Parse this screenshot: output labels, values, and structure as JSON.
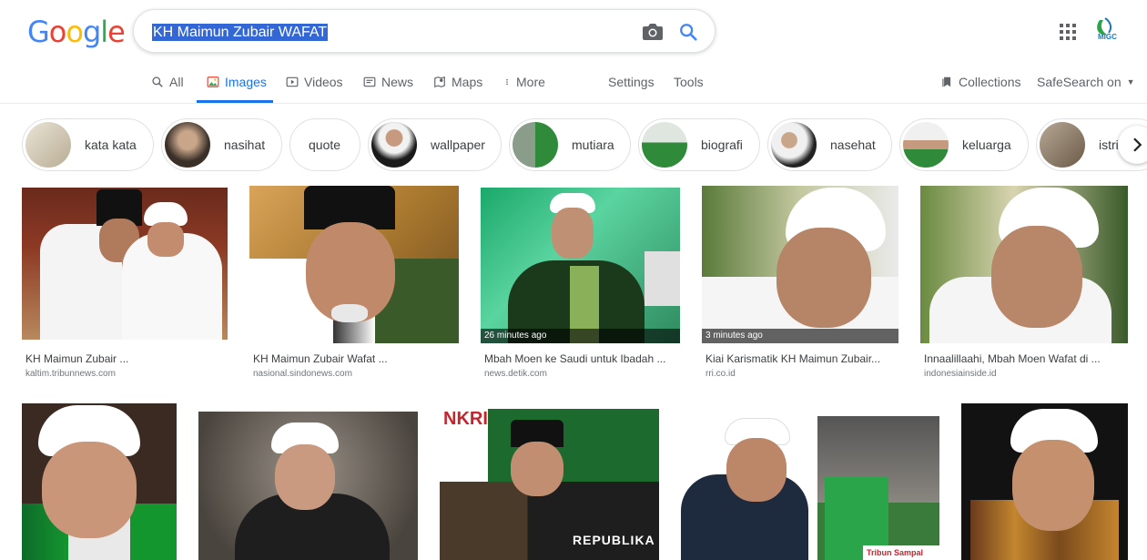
{
  "header": {
    "logo_text": "Google",
    "search_query": "KH Maimun Zubair WAFAT",
    "camera_icon": "camera-icon",
    "search_icon": "search-icon",
    "apps_icon": "apps-grid-icon",
    "account_label": "MIGC"
  },
  "nav": {
    "tabs": [
      {
        "label": "All",
        "icon": "search-icon"
      },
      {
        "label": "Images",
        "icon": "image-icon",
        "active": true
      },
      {
        "label": "Videos",
        "icon": "video-icon"
      },
      {
        "label": "News",
        "icon": "news-icon"
      },
      {
        "label": "Maps",
        "icon": "map-icon"
      },
      {
        "label": "More",
        "icon": "more-vert-icon"
      }
    ],
    "settings": "Settings",
    "tools": "Tools",
    "collections": "Collections",
    "safesearch": "SafeSearch on"
  },
  "chips": [
    {
      "label": "kata kata"
    },
    {
      "label": "nasihat"
    },
    {
      "label": "quote"
    },
    {
      "label": "wallpaper"
    },
    {
      "label": "mutiara"
    },
    {
      "label": "biografi"
    },
    {
      "label": "nasehat"
    },
    {
      "label": "keluarga"
    },
    {
      "label": "istri"
    }
  ],
  "results_row1": [
    {
      "title": "KH Maimun Zubair ...",
      "domain": "kaltim.tribunnews.com",
      "badge": ""
    },
    {
      "title": "KH Maimun Zubair Wafat ...",
      "domain": "nasional.sindonews.com",
      "badge": ""
    },
    {
      "title": "Mbah Moen ke Saudi untuk Ibadah ...",
      "domain": "news.detik.com",
      "badge": "26 minutes ago"
    },
    {
      "title": "Kiai Karismatik KH Maimun Zubair...",
      "domain": "rri.co.id",
      "badge": "3 minutes ago"
    },
    {
      "title": "Innaalillaahi, Mbah Moen Wafat di ...",
      "domain": "indonesiainside.id",
      "badge": ""
    }
  ],
  "results_row2_overlay_text": [
    "REPUBLIKA",
    "Tribun Sampal"
  ],
  "colors": {
    "accent": "#1a73e8",
    "selection": "#3367d6"
  }
}
